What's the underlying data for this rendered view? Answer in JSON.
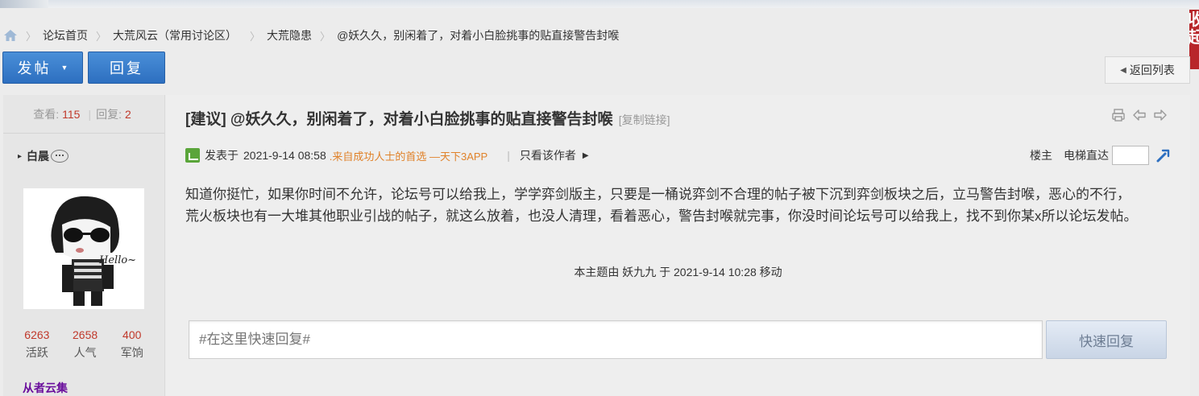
{
  "side_tab": {
    "label_line1": "收",
    "label_line2": "起"
  },
  "breadcrumb": {
    "items": [
      {
        "label": "论坛首页"
      },
      {
        "label": "大荒风云（常用讨论区）"
      },
      {
        "label": "大荒隐患"
      },
      {
        "label": "@妖久久，别闲着了，对着小白脸挑事的贴直接警告封喉"
      }
    ]
  },
  "toolbar": {
    "post_label": "发帖",
    "reply_label": "回复",
    "back_label": "返回列表"
  },
  "author": {
    "views_label": "查看:",
    "views": "115",
    "replies_label": "回复:",
    "replies": "2",
    "name": "白晨",
    "avatar_text": "Hello~",
    "stats": [
      {
        "value": "6263",
        "label": "活跃"
      },
      {
        "value": "2658",
        "label": "人气"
      },
      {
        "value": "400",
        "label": "军饷"
      }
    ],
    "group": "从者云集"
  },
  "post": {
    "title": "[建议] @妖久久，别闲着了，对着小白脸挑事的贴直接警告封喉",
    "copy_link": "[复制链接]",
    "posted_prefix": "发表于",
    "posted_time": "2021-9-14 08:58",
    "source": ".来自成功人士的首选 —天下3APP",
    "only_author": "只看该作者",
    "floor_label": "楼主",
    "jump_label": "电梯直达",
    "content_line1": "知道你挺忙，如果你时间不允许，论坛号可以给我上，学学弈剑版主，只要是一桶说弈剑不合理的帖子被下沉到弈剑板块之后，立马警告封喉，恶心的不行，",
    "content_line2": "荒火板块也有一大堆其他职业引战的帖子，就这么放着，也没人清理，看着恶心，警告封喉就完事，你没时间论坛号可以给我上，找不到你某x所以论坛发帖。",
    "moved_note": "本主题由 妖九九 于 2021-9-14 10:28 移动"
  },
  "quick_reply": {
    "placeholder": "#在这里快速回复#",
    "button_label": "快速回复"
  },
  "colors": {
    "primary_button": "#2d6fc0",
    "stat_number": "#c0392b",
    "group_name": "#6a0e9c",
    "source_link": "#e0822a"
  }
}
